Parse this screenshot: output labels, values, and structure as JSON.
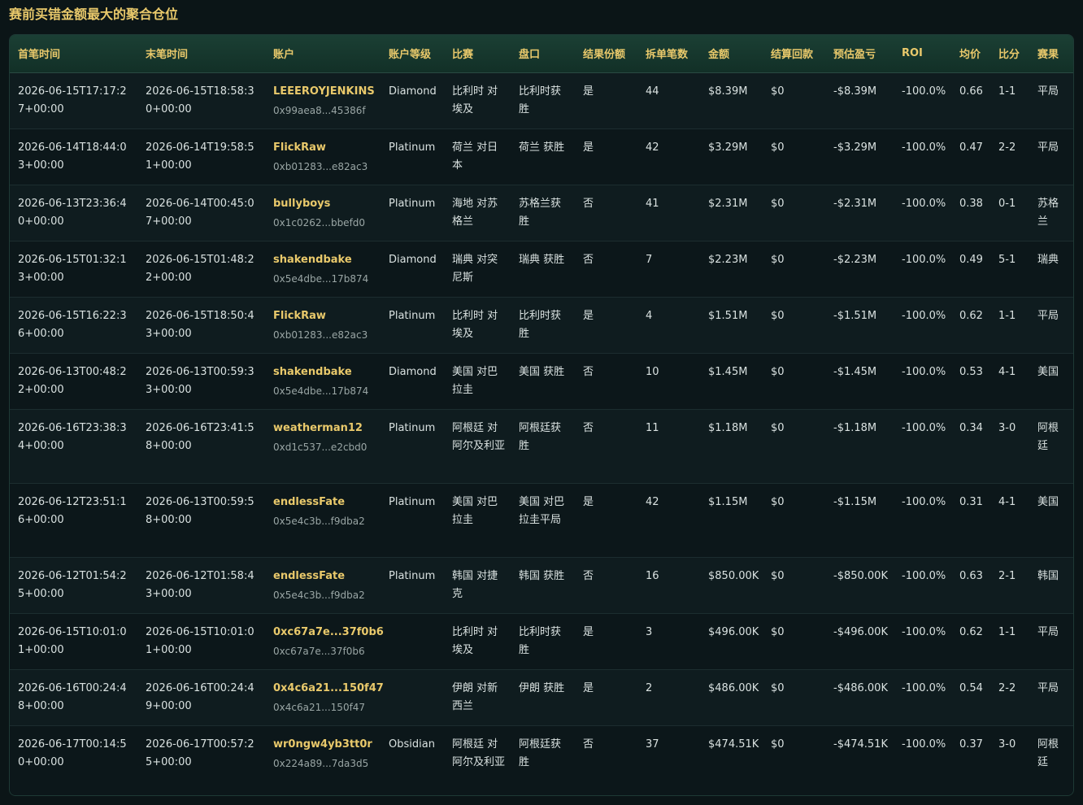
{
  "page": {
    "title": "赛前买错金额最大的聚合仓位"
  },
  "table": {
    "headers": [
      "首笔时间",
      "末笔时间",
      "账户",
      "账户等级",
      "比赛",
      "盘口",
      "结果份额",
      "拆单笔数",
      "金额",
      "结算回款",
      "预估盈亏",
      "ROI",
      "均价",
      "比分",
      "赛果"
    ],
    "rows": [
      {
        "first": "2026-06-15T17:17:27+00:00",
        "last": "2026-06-15T18:58:30+00:00",
        "account": "LEEEROYJENKINS",
        "address": "0x99aea8...45386f",
        "tier": "Diamond",
        "match": "比利时 对埃及",
        "market": "比利时获胜",
        "outcome": "是",
        "splits": "44",
        "amount": "$8.39M",
        "payout": "$0",
        "pnl": "-$8.39M",
        "roi": "-100.0%",
        "avg": "0.66",
        "score": "1-1",
        "result": "平局"
      },
      {
        "first": "2026-06-14T18:44:03+00:00",
        "last": "2026-06-14T19:58:51+00:00",
        "account": "FlickRaw",
        "address": "0xb01283...e82ac3",
        "tier": "Platinum",
        "match": "荷兰 对日本",
        "market": "荷兰 获胜",
        "outcome": "是",
        "splits": "42",
        "amount": "$3.29M",
        "payout": "$0",
        "pnl": "-$3.29M",
        "roi": "-100.0%",
        "avg": "0.47",
        "score": "2-2",
        "result": "平局"
      },
      {
        "first": "2026-06-13T23:36:40+00:00",
        "last": "2026-06-14T00:45:07+00:00",
        "account": "bullyboys",
        "address": "0x1c0262...bbefd0",
        "tier": "Platinum",
        "match": "海地 对苏格兰",
        "market": "苏格兰获胜",
        "outcome": "否",
        "splits": "41",
        "amount": "$2.31M",
        "payout": "$0",
        "pnl": "-$2.31M",
        "roi": "-100.0%",
        "avg": "0.38",
        "score": "0-1",
        "result": "苏格兰"
      },
      {
        "first": "2026-06-15T01:32:13+00:00",
        "last": "2026-06-15T01:48:22+00:00",
        "account": "shakendbake",
        "address": "0x5e4dbe...17b874",
        "tier": "Diamond",
        "match": "瑞典 对突尼斯",
        "market": "瑞典 获胜",
        "outcome": "否",
        "splits": "7",
        "amount": "$2.23M",
        "payout": "$0",
        "pnl": "-$2.23M",
        "roi": "-100.0%",
        "avg": "0.49",
        "score": "5-1",
        "result": "瑞典"
      },
      {
        "first": "2026-06-15T16:22:36+00:00",
        "last": "2026-06-15T18:50:43+00:00",
        "account": "FlickRaw",
        "address": "0xb01283...e82ac3",
        "tier": "Platinum",
        "match": "比利时 对埃及",
        "market": "比利时获胜",
        "outcome": "是",
        "splits": "4",
        "amount": "$1.51M",
        "payout": "$0",
        "pnl": "-$1.51M",
        "roi": "-100.0%",
        "avg": "0.62",
        "score": "1-1",
        "result": "平局"
      },
      {
        "first": "2026-06-13T00:48:22+00:00",
        "last": "2026-06-13T00:59:33+00:00",
        "account": "shakendbake",
        "address": "0x5e4dbe...17b874",
        "tier": "Diamond",
        "match": "美国 对巴拉圭",
        "market": "美国 获胜",
        "outcome": "否",
        "splits": "10",
        "amount": "$1.45M",
        "payout": "$0",
        "pnl": "-$1.45M",
        "roi": "-100.0%",
        "avg": "0.53",
        "score": "4-1",
        "result": "美国"
      },
      {
        "first": "2026-06-16T23:38:34+00:00",
        "last": "2026-06-16T23:41:58+00:00",
        "account": "weatherman12",
        "address": "0xd1c537...e2cbd0",
        "tier": "Platinum",
        "match": "阿根廷 对阿尔及利亚",
        "market": "阿根廷获胜",
        "outcome": "否",
        "splits": "11",
        "amount": "$1.18M",
        "payout": "$0",
        "pnl": "-$1.18M",
        "roi": "-100.0%",
        "avg": "0.34",
        "score": "3-0",
        "result": "阿根廷"
      },
      {
        "first": "2026-06-12T23:51:16+00:00",
        "last": "2026-06-13T00:59:58+00:00",
        "account": "endlessFate",
        "address": "0x5e4c3b...f9dba2",
        "tier": "Platinum",
        "match": "美国 对巴拉圭",
        "market": "美国 对巴拉圭平局",
        "outcome": "是",
        "splits": "42",
        "amount": "$1.15M",
        "payout": "$0",
        "pnl": "-$1.15M",
        "roi": "-100.0%",
        "avg": "0.31",
        "score": "4-1",
        "result": "美国"
      },
      {
        "first": "2026-06-12T01:54:25+00:00",
        "last": "2026-06-12T01:58:43+00:00",
        "account": "endlessFate",
        "address": "0x5e4c3b...f9dba2",
        "tier": "Platinum",
        "match": "韩国 对捷克",
        "market": "韩国 获胜",
        "outcome": "否",
        "splits": "16",
        "amount": "$850.00K",
        "payout": "$0",
        "pnl": "-$850.00K",
        "roi": "-100.0%",
        "avg": "0.63",
        "score": "2-1",
        "result": "韩国"
      },
      {
        "first": "2026-06-15T10:01:01+00:00",
        "last": "2026-06-15T10:01:01+00:00",
        "account": "0xc67a7e...37f0b6",
        "address": "0xc67a7e...37f0b6",
        "tier": "",
        "match": "比利时 对埃及",
        "market": "比利时获胜",
        "outcome": "是",
        "splits": "3",
        "amount": "$496.00K",
        "payout": "$0",
        "pnl": "-$496.00K",
        "roi": "-100.0%",
        "avg": "0.62",
        "score": "1-1",
        "result": "平局"
      },
      {
        "first": "2026-06-16T00:24:48+00:00",
        "last": "2026-06-16T00:24:49+00:00",
        "account": "0x4c6a21...150f47",
        "address": "0x4c6a21...150f47",
        "tier": "",
        "match": "伊朗 对新西兰",
        "market": "伊朗 获胜",
        "outcome": "是",
        "splits": "2",
        "amount": "$486.00K",
        "payout": "$0",
        "pnl": "-$486.00K",
        "roi": "-100.0%",
        "avg": "0.54",
        "score": "2-2",
        "result": "平局"
      },
      {
        "first": "2026-06-17T00:14:50+00:00",
        "last": "2026-06-17T00:57:25+00:00",
        "account": "wr0ngw4yb3tt0r",
        "address": "0x224a89...7da3d5",
        "tier": "Obsidian",
        "match": "阿根廷 对阿尔及利亚",
        "market": "阿根廷获胜",
        "outcome": "否",
        "splits": "37",
        "amount": "$474.51K",
        "payout": "$0",
        "pnl": "-$474.51K",
        "roi": "-100.0%",
        "avg": "0.37",
        "score": "3-0",
        "result": "阿根廷"
      }
    ]
  }
}
